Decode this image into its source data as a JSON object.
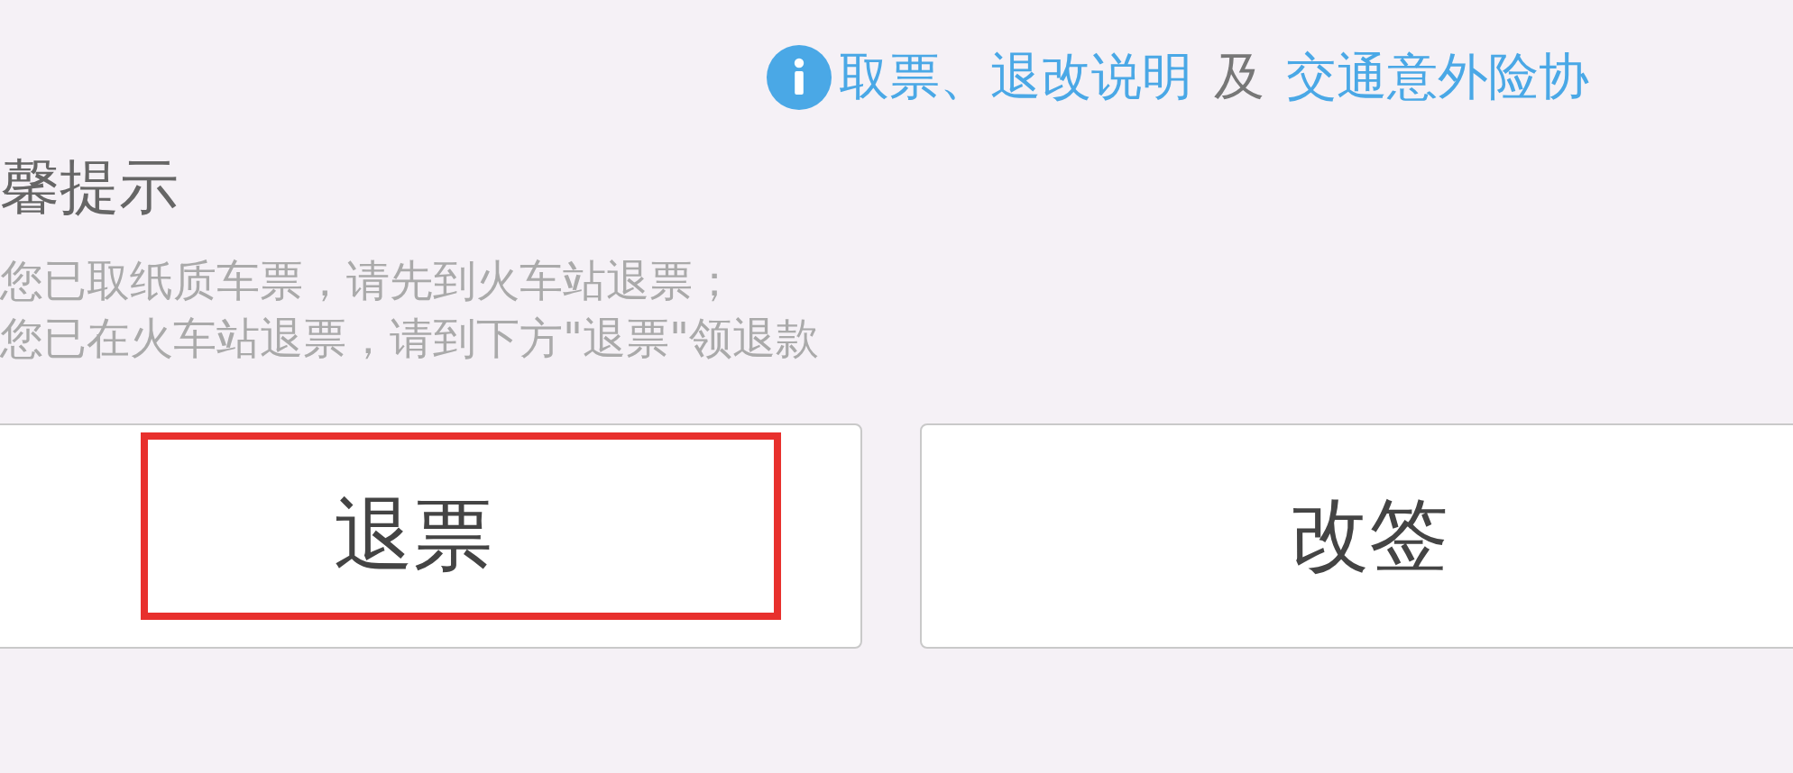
{
  "notice_links": [
    {
      "kind": "link",
      "text": "取票、退改说明"
    },
    {
      "kind": "text",
      "text": "及"
    },
    {
      "kind": "link",
      "text": "交通意外险协"
    }
  ],
  "tips": {
    "title": "馨提示",
    "lines": [
      "您已取纸质车票，请先到火车站退票；",
      "您已在火车站退票，请到下方\"退票\"领退款"
    ]
  },
  "buttons": [
    {
      "label": "退票",
      "highlighted": true
    },
    {
      "label": "改签",
      "highlighted": false
    }
  ]
}
